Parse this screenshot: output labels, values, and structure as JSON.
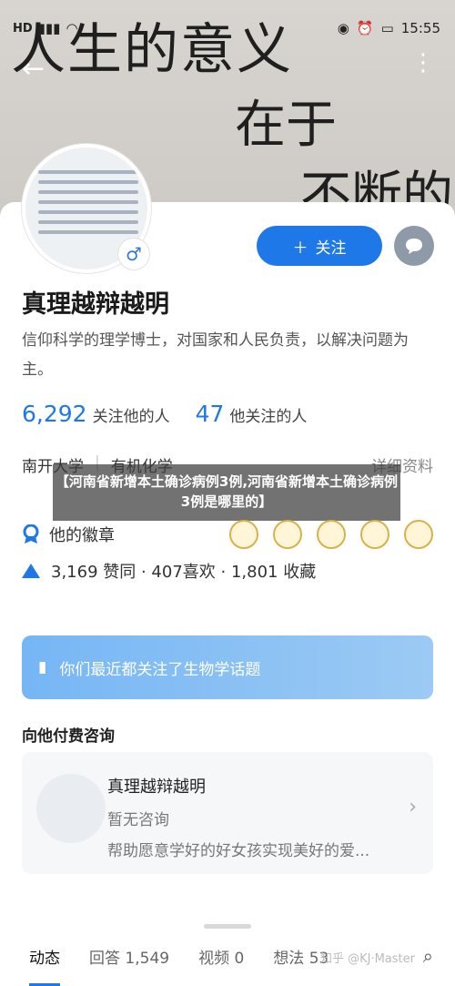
{
  "cover": {
    "line1": "人生的意义",
    "line2": "在于",
    "line3": "不断的"
  },
  "status_bar": {
    "network": "HD",
    "time": "15:55"
  },
  "profile": {
    "follow_label": "关注",
    "name": "真理越辩越明",
    "bio": "信仰科学的理学博士，对国家和人民负责，以解决问题为主。",
    "followers_count": "6,292",
    "followers_label": "关注他的人",
    "following_count": "47",
    "following_label": "他关注的人",
    "school": "南开大学",
    "major": "有机化学",
    "details_label": "详细资料",
    "badges_label": "他的徽章",
    "stats_line": "3,169 赞同 · 407喜欢 · 1,801 收藏"
  },
  "banner": {
    "text": "【河南省新增本土确诊病例3例,河南省新增本土确诊病例3例是哪里的】"
  },
  "topic": {
    "text": "你们最近都关注了生物学话题"
  },
  "consult": {
    "section_title": "向他付费咨询",
    "name": "真理越辩越明",
    "status": "暂无咨询",
    "desc": "帮助愿意学好的好女孩实现美好的爱..."
  },
  "tabs": {
    "items": [
      "动态",
      "回答 1,549",
      "视频 0",
      "想法 53"
    ],
    "watermark": "知乎 @KJ·Master"
  },
  "colors": {
    "accent": "#1e78e8",
    "topic_gradient_start": "#76b6f5"
  }
}
